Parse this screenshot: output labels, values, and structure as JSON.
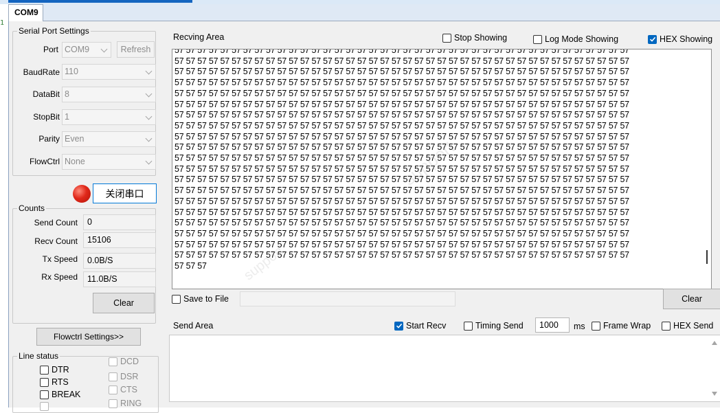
{
  "tab": {
    "label": "COM9"
  },
  "gutter": {
    "line_number": "1"
  },
  "serial": {
    "legend": "Serial Port Settings",
    "port_label": "Port",
    "port_value": "COM9",
    "refresh_label": "Refresh",
    "baud_label": "BaudRate",
    "baud_value": "110",
    "databit_label": "DataBit",
    "databit_value": "8",
    "stopbit_label": "StopBit",
    "stopbit_value": "1",
    "parity_label": "Parity",
    "parity_value": "Even",
    "flowctrl_label": "FlowCtrl",
    "flowctrl_value": "None",
    "close_port_label": "关闭串口",
    "led_color": "#e0281a"
  },
  "counts": {
    "legend": "Counts",
    "send_count_label": "Send Count",
    "send_count_value": "0",
    "recv_count_label": "Recv Count",
    "recv_count_value": "15106",
    "tx_speed_label": "Tx Speed",
    "tx_speed_value": "0.0B/S",
    "rx_speed_label": "Rx Speed",
    "rx_speed_value": "11.0B/S",
    "clear_label": "Clear"
  },
  "flowctrl_settings_label": "Flowctrl Settings>>",
  "line_status": {
    "legend": "Line status",
    "dtr": "DTR",
    "rts": "RTS",
    "break": "BREAK",
    "dcd": "DCD",
    "dsr": "DSR",
    "cts": "CTS",
    "ring": "RING"
  },
  "recv": {
    "title": "Recving Area",
    "stop_showing_label": "Stop Showing",
    "log_mode_label": "Log Mode Showing",
    "hex_showing_label": "HEX Showing",
    "hex_byte": "57",
    "bytes_per_row": 40,
    "full_rows": 20,
    "tail_bytes": 3,
    "save_to_file_label": "Save to File",
    "clear_label": "Clear"
  },
  "send": {
    "title": "Send Area",
    "start_recv_label": "Start Recv",
    "timing_send_label": "Timing Send",
    "timing_value": "1000",
    "ms_label": "ms",
    "frame_wrap_label": "Frame Wrap",
    "hex_send_label": "HEX Send"
  },
  "colors": {
    "accent": "#0067c0",
    "led": "#e0281a"
  }
}
